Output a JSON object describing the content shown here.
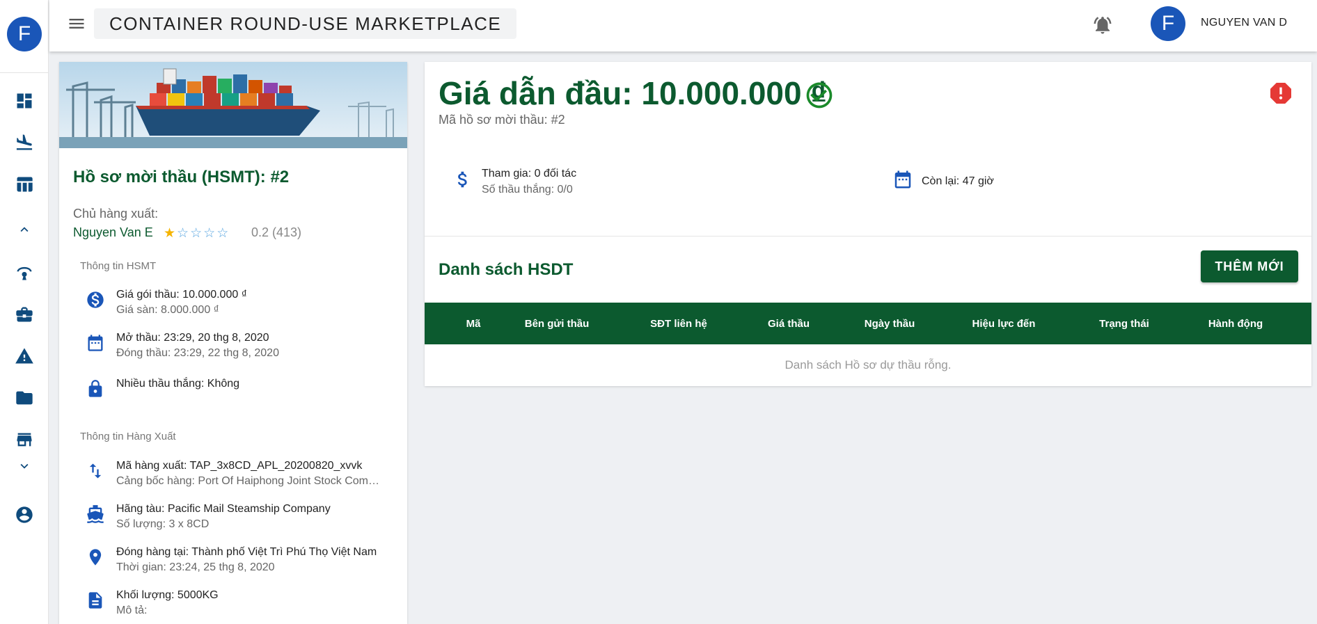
{
  "app": {
    "logo_letter": "F",
    "title": "CONTAINER ROUND-USE MARKETPLACE"
  },
  "sidebar": {
    "items": [
      {
        "icon": "dashboard-icon"
      },
      {
        "icon": "plane-landing-icon"
      },
      {
        "icon": "table-icon"
      },
      {
        "icon": "chevron-up-icon"
      },
      {
        "icon": "wifi-tethering-icon"
      },
      {
        "icon": "briefcase-icon"
      },
      {
        "icon": "warning-icon"
      },
      {
        "icon": "folder-icon"
      },
      {
        "icon": "store-icon"
      },
      {
        "icon": "chevron-down-icon"
      },
      {
        "icon": "account-circle-icon"
      }
    ]
  },
  "user": {
    "avatar_letter": "F",
    "name": "NGUYEN VAN D"
  },
  "hsmt": {
    "title": "Hồ sơ mời thầu (HSMT): #2",
    "owner_label": "Chủ hàng xuất:",
    "owner_name": "Nguyen Van E",
    "stars_filled": 0.5,
    "stars_total": 5,
    "rating_text": "0.2 (413)",
    "section_info": "Thông tin HSMT",
    "price_line": "Giá gói thầu: 10.000.000 ₫",
    "floor_line": "Giá sàn: 8.000.000 ₫",
    "open_line": "Mở thầu: 23:29, 20 thg 8, 2020",
    "close_line": "Đóng thầu: 23:29, 22 thg 8, 2020",
    "multi_line": "Nhiều thầu thắng: Không",
    "section_goods": "Thông tin Hàng Xuất",
    "goods_code_line": "Mã hàng xuất: TAP_3x8CD_APL_20200820_xvvk",
    "port_line": "Cảng bốc hàng: Port Of Haiphong Joint Stock Company",
    "carrier_line": "Hãng tàu: Pacific Mail Steamship Company",
    "qty_line": "Số lượng: 3 x 8CD",
    "pack_place_line": "Đóng hàng tại: Thành phố Việt Trì Phú Thọ Việt Nam",
    "pack_time_line": "Thời gian: 23:24, 25 thg 8, 2020",
    "weight_line": "Khối lượng: 5000KG",
    "desc_line": "Mô tả:"
  },
  "main": {
    "lead_price": "Giá dẫn đầu: 10.000.000 ₫",
    "hoso_code": "Mã hồ sơ mời thầu: #2",
    "participants": "Tham gia: 0 đối tác",
    "wins": "Số thầu thắng: 0/0",
    "remaining": "Còn lại: 47 giờ",
    "list_title": "Danh sách HSDT",
    "add_button": "THÊM MỚI",
    "columns": [
      "Mã",
      "Bên gửi thầu",
      "SĐT liên hệ",
      "Giá thầu",
      "Ngày thầu",
      "Hiệu lực đến",
      "Trạng thái",
      "Hành động"
    ],
    "empty_message": "Danh sách Hồ sơ dự thầu rỗng."
  },
  "colors": {
    "primary_green": "#0c5a2f",
    "accent_blue": "#1a56b8",
    "alert_red": "#e53935",
    "check_green": "#1a8a2a"
  }
}
